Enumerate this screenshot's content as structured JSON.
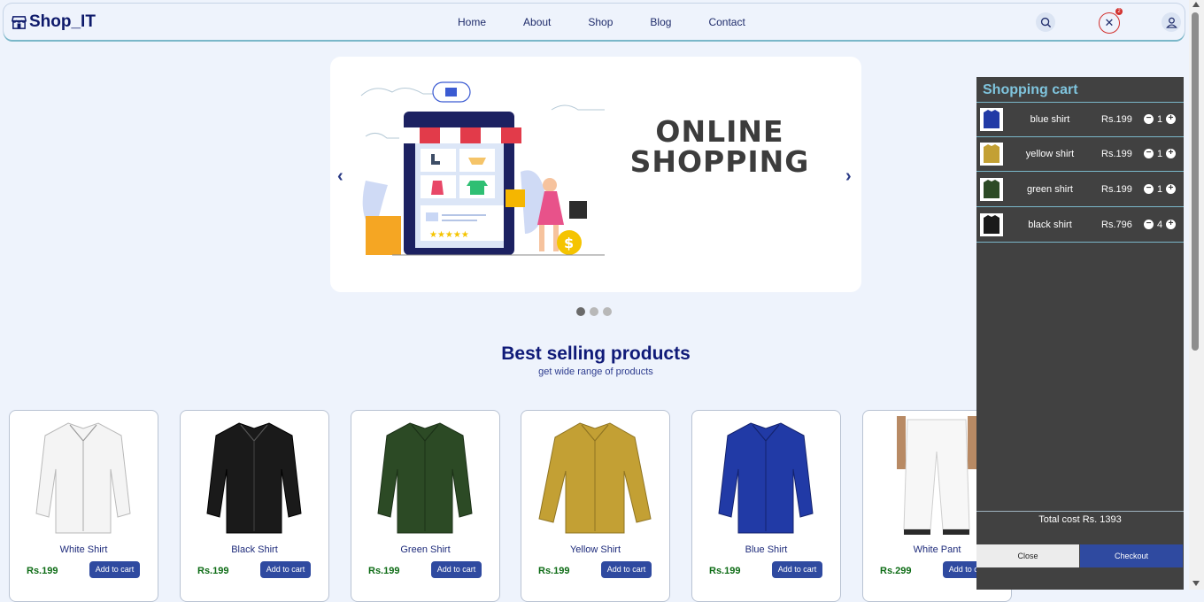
{
  "brand": {
    "name": "Shop_IT"
  },
  "nav": {
    "links": [
      "Home",
      "About",
      "Shop",
      "Blog",
      "Contact"
    ]
  },
  "cart_badge": {
    "count": "2"
  },
  "carousel": {
    "title_line1": "ONLINE",
    "title_line2": "SHOPPING",
    "prev": "‹",
    "next": "›",
    "slide_count": 3,
    "active_slide": 1
  },
  "section": {
    "title": "Best selling products",
    "subtitle": "get wide range of products"
  },
  "products": [
    {
      "name": "White Shirt",
      "price": "Rs.199",
      "button": "Add to cart",
      "color": "#f4f4f4"
    },
    {
      "name": "Black Shirt",
      "price": "Rs.199",
      "button": "Add to cart",
      "color": "#1a1a1a"
    },
    {
      "name": "Green Shirt",
      "price": "Rs.199",
      "button": "Add to cart",
      "color": "#2c4a25"
    },
    {
      "name": "Yellow Shirt",
      "price": "Rs.199",
      "button": "Add to cart",
      "color": "#c3a034"
    },
    {
      "name": "Blue Shirt",
      "price": "Rs.199",
      "button": "Add to cart",
      "color": "#213aa6"
    },
    {
      "name": "White Pant",
      "price": "Rs.299",
      "button": "Add to cart",
      "color": "#f4f4f4"
    }
  ],
  "cart": {
    "title": "Shopping cart",
    "items": [
      {
        "name": "blue shirt",
        "price": "Rs.199",
        "qty": "1",
        "color": "#213aa6"
      },
      {
        "name": "yellow shirt",
        "price": "Rs.199",
        "qty": "1",
        "color": "#c3a034"
      },
      {
        "name": "green shirt",
        "price": "Rs.199",
        "qty": "1",
        "color": "#2c4a25"
      },
      {
        "name": "black shirt",
        "price": "Rs.796",
        "qty": "4",
        "color": "#1a1a1a"
      }
    ],
    "total": "Total cost Rs. 1393",
    "close_label": "Close",
    "checkout_label": "Checkout"
  }
}
